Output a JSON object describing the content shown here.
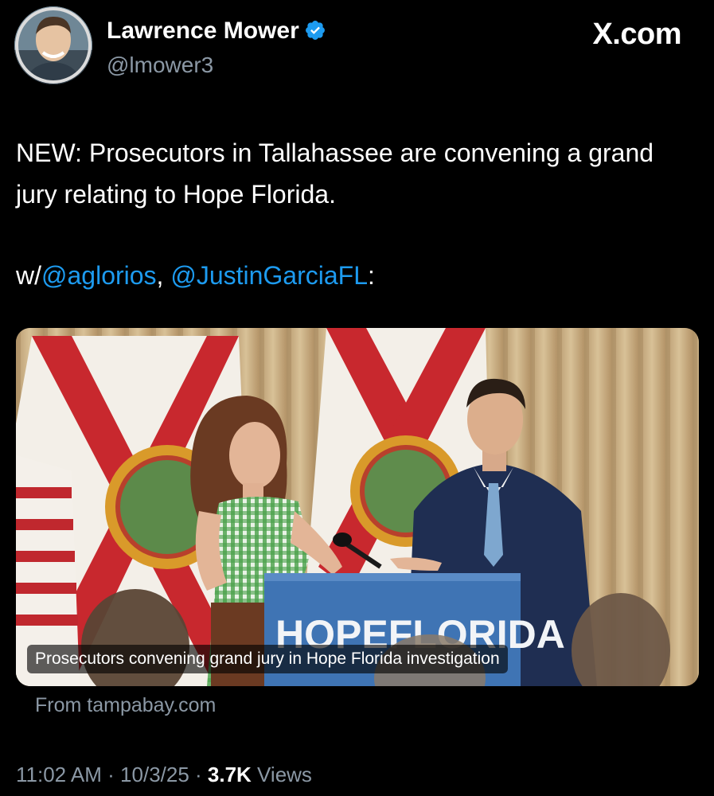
{
  "author": {
    "name": "Lawrence Mower",
    "handle": "@lmower3",
    "verified_icon": "verified-badge-icon"
  },
  "brand": {
    "site": "X.com"
  },
  "tweet": {
    "line1": "NEW: Prosecutors in Tallahassee are convening a grand jury relating to Hope Florida.",
    "mentions_prefix": "w/",
    "mention_1": "@aglorios",
    "separator": ", ",
    "mention_2": "@JustinGarciaFL",
    "suffix": ":"
  },
  "card": {
    "podium_sign": "HOPEFLORIDA",
    "caption": "Prosecutors convening grand jury in Hope Florida investigation",
    "source": "From tampabay.com"
  },
  "meta": {
    "time": "11:02 AM",
    "dot": " · ",
    "date": "10/3/25",
    "views_count": "3.7K",
    "views_label": " Views"
  },
  "colors": {
    "background": "#000000",
    "text": "#ffffff",
    "secondary": "#8b98a5",
    "link": "#1d9bf0",
    "verified": "#1d9bf0"
  }
}
